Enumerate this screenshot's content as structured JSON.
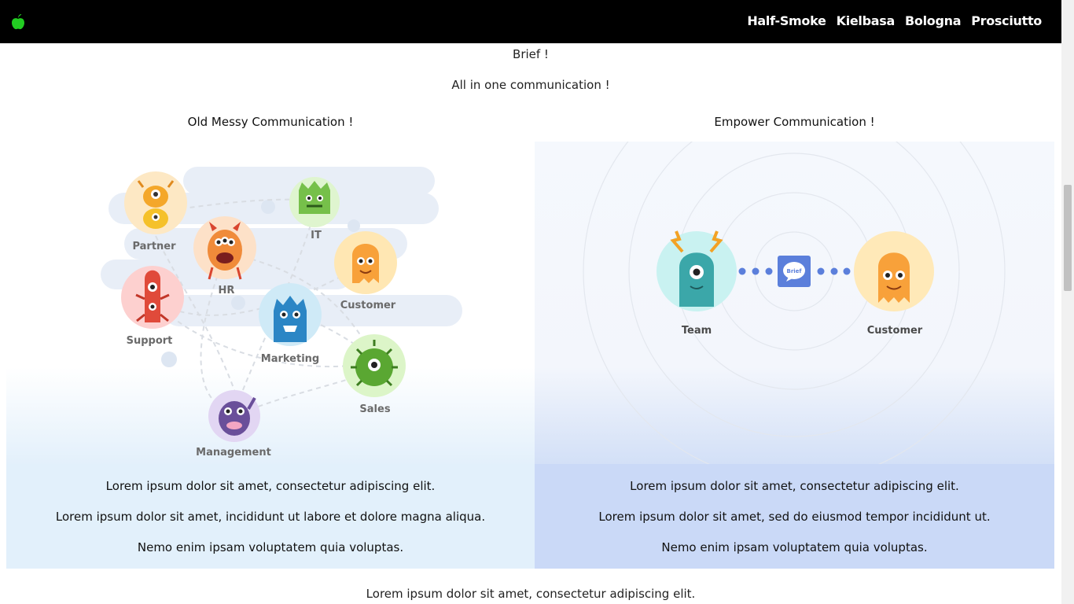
{
  "nav": {
    "links": [
      "Half-Smoke",
      "Kielbasa",
      "Bologna",
      "Prosciutto"
    ],
    "logo_icon": "apple-icon",
    "logo_color": "#22cc22"
  },
  "header": {
    "brand": "Brief !",
    "tagline": "All in one communication !"
  },
  "left": {
    "title": "Old Messy Communication !",
    "labels": {
      "partner": "Partner",
      "it": "IT",
      "hr": "HR",
      "customer": "Customer",
      "support": "Support",
      "marketing": "Marketing",
      "sales": "Sales",
      "management": "Management"
    },
    "paragraphs": [
      "Lorem ipsum dolor sit amet, consectetur adipiscing elit.",
      "Lorem ipsum dolor sit amet, incididunt ut labore et dolore magna aliqua.",
      "Nemo enim ipsam voluptatem quia voluptas."
    ]
  },
  "right": {
    "title": "Empower Communication !",
    "labels": {
      "team": "Team",
      "customer": "Customer",
      "brief_badge": "Brief"
    },
    "paragraphs": [
      "Lorem ipsum dolor sit amet, consectetur adipiscing elit.",
      "Lorem ipsum dolor sit amet, sed do eiusmod tempor incididunt ut.",
      "Nemo enim ipsam voluptatem quia voluptas."
    ]
  },
  "footer": {
    "text": "Lorem ipsum dolor sit amet, consectetur adipiscing elit."
  },
  "colors": {
    "navbar": "#000000",
    "left_text_bg": "#e2f0fb",
    "right_text_bg": "#cad9f7",
    "brief_badge": "#5b7fdb"
  }
}
